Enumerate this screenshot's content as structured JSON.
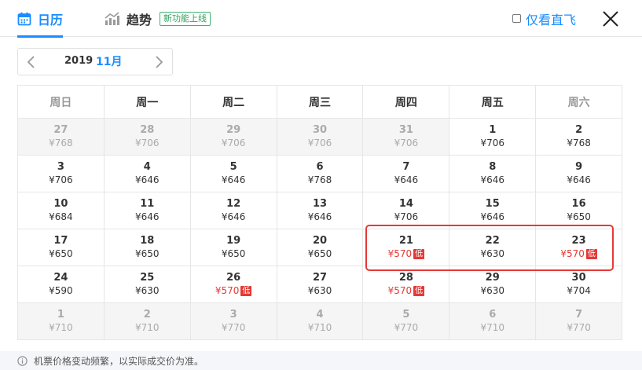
{
  "header": {
    "tab_calendar": "日历",
    "tab_trend": "趋势",
    "trend_badge": "新功能上线",
    "direct_label": "仅看直飞",
    "accent": "#1a8cff"
  },
  "month_selector": {
    "year": "2019",
    "month": "11月"
  },
  "weekdays": [
    "周日",
    "周一",
    "周二",
    "周三",
    "周四",
    "周五",
    "周六"
  ],
  "low_label": "低",
  "low_color": "#e53935",
  "weeks": [
    [
      {
        "day": "27",
        "price": "¥768",
        "dim": true
      },
      {
        "day": "28",
        "price": "¥706",
        "dim": true
      },
      {
        "day": "29",
        "price": "¥706",
        "dim": true
      },
      {
        "day": "30",
        "price": "¥706",
        "dim": true
      },
      {
        "day": "31",
        "price": "¥706",
        "dim": true
      },
      {
        "day": "1",
        "price": "¥706"
      },
      {
        "day": "2",
        "price": "¥768"
      }
    ],
    [
      {
        "day": "3",
        "price": "¥706"
      },
      {
        "day": "4",
        "price": "¥646"
      },
      {
        "day": "5",
        "price": "¥646"
      },
      {
        "day": "6",
        "price": "¥768"
      },
      {
        "day": "7",
        "price": "¥646"
      },
      {
        "day": "8",
        "price": "¥646"
      },
      {
        "day": "9",
        "price": "¥646"
      }
    ],
    [
      {
        "day": "10",
        "price": "¥684"
      },
      {
        "day": "11",
        "price": "¥646"
      },
      {
        "day": "12",
        "price": "¥646"
      },
      {
        "day": "13",
        "price": "¥646"
      },
      {
        "day": "14",
        "price": "¥706"
      },
      {
        "day": "15",
        "price": "¥646"
      },
      {
        "day": "16",
        "price": "¥650"
      }
    ],
    [
      {
        "day": "17",
        "price": "¥650"
      },
      {
        "day": "18",
        "price": "¥650"
      },
      {
        "day": "19",
        "price": "¥650"
      },
      {
        "day": "20",
        "price": "¥650"
      },
      {
        "day": "21",
        "price": "¥570",
        "low": true
      },
      {
        "day": "22",
        "price": "¥630"
      },
      {
        "day": "23",
        "price": "¥570",
        "low": true
      }
    ],
    [
      {
        "day": "24",
        "price": "¥590"
      },
      {
        "day": "25",
        "price": "¥630"
      },
      {
        "day": "26",
        "price": "¥570",
        "low": true
      },
      {
        "day": "27",
        "price": "¥630"
      },
      {
        "day": "28",
        "price": "¥570",
        "low": true
      },
      {
        "day": "29",
        "price": "¥630"
      },
      {
        "day": "30",
        "price": "¥704"
      }
    ],
    [
      {
        "day": "1",
        "price": "¥710",
        "dim": true
      },
      {
        "day": "2",
        "price": "¥710",
        "dim": true
      },
      {
        "day": "3",
        "price": "¥770",
        "dim": true
      },
      {
        "day": "4",
        "price": "¥710",
        "dim": true
      },
      {
        "day": "5",
        "price": "¥770",
        "dim": true
      },
      {
        "day": "6",
        "price": "¥710",
        "dim": true
      },
      {
        "day": "7",
        "price": "¥770",
        "dim": true
      }
    ]
  ],
  "footer": {
    "notice": "机票价格变动频繁，以实际成交价为准。"
  }
}
